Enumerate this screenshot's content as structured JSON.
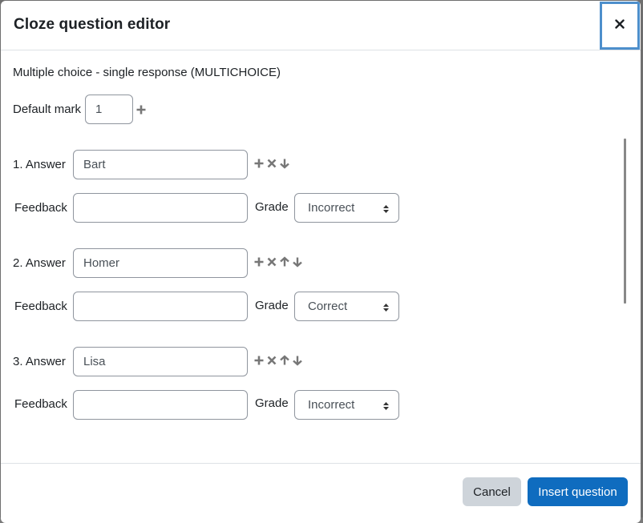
{
  "dialog": {
    "title": "Cloze question editor",
    "close_icon": "close-icon"
  },
  "body": {
    "question_type": "Multiple choice - single response (MULTICHOICE)",
    "default_mark": {
      "label": "Default mark",
      "value": "1",
      "add_icon": "plus-icon"
    },
    "answers": [
      {
        "label": "1. Answer",
        "value": "Bart",
        "feedback_label": "Feedback",
        "feedback_value": "",
        "grade_label": "Grade",
        "grade_value": "Incorrect",
        "actions": [
          "plus-icon",
          "times-icon",
          "arrow-down-icon"
        ]
      },
      {
        "label": "2. Answer",
        "value": "Homer",
        "feedback_label": "Feedback",
        "feedback_value": "",
        "grade_label": "Grade",
        "grade_value": "Correct",
        "actions": [
          "plus-icon",
          "times-icon",
          "arrow-up-icon",
          "arrow-down-icon"
        ]
      },
      {
        "label": "3. Answer",
        "value": "Lisa",
        "feedback_label": "Feedback",
        "feedback_value": "",
        "grade_label": "Grade",
        "grade_value": "Incorrect",
        "actions": [
          "plus-icon",
          "times-icon",
          "arrow-up-icon",
          "arrow-down-icon"
        ]
      }
    ]
  },
  "footer": {
    "cancel_label": "Cancel",
    "insert_label": "Insert question"
  },
  "colors": {
    "primary": "#0f6cbf",
    "secondary": "#ced4da",
    "focus_ring": "#4d8fcc",
    "icon": "#777777"
  }
}
